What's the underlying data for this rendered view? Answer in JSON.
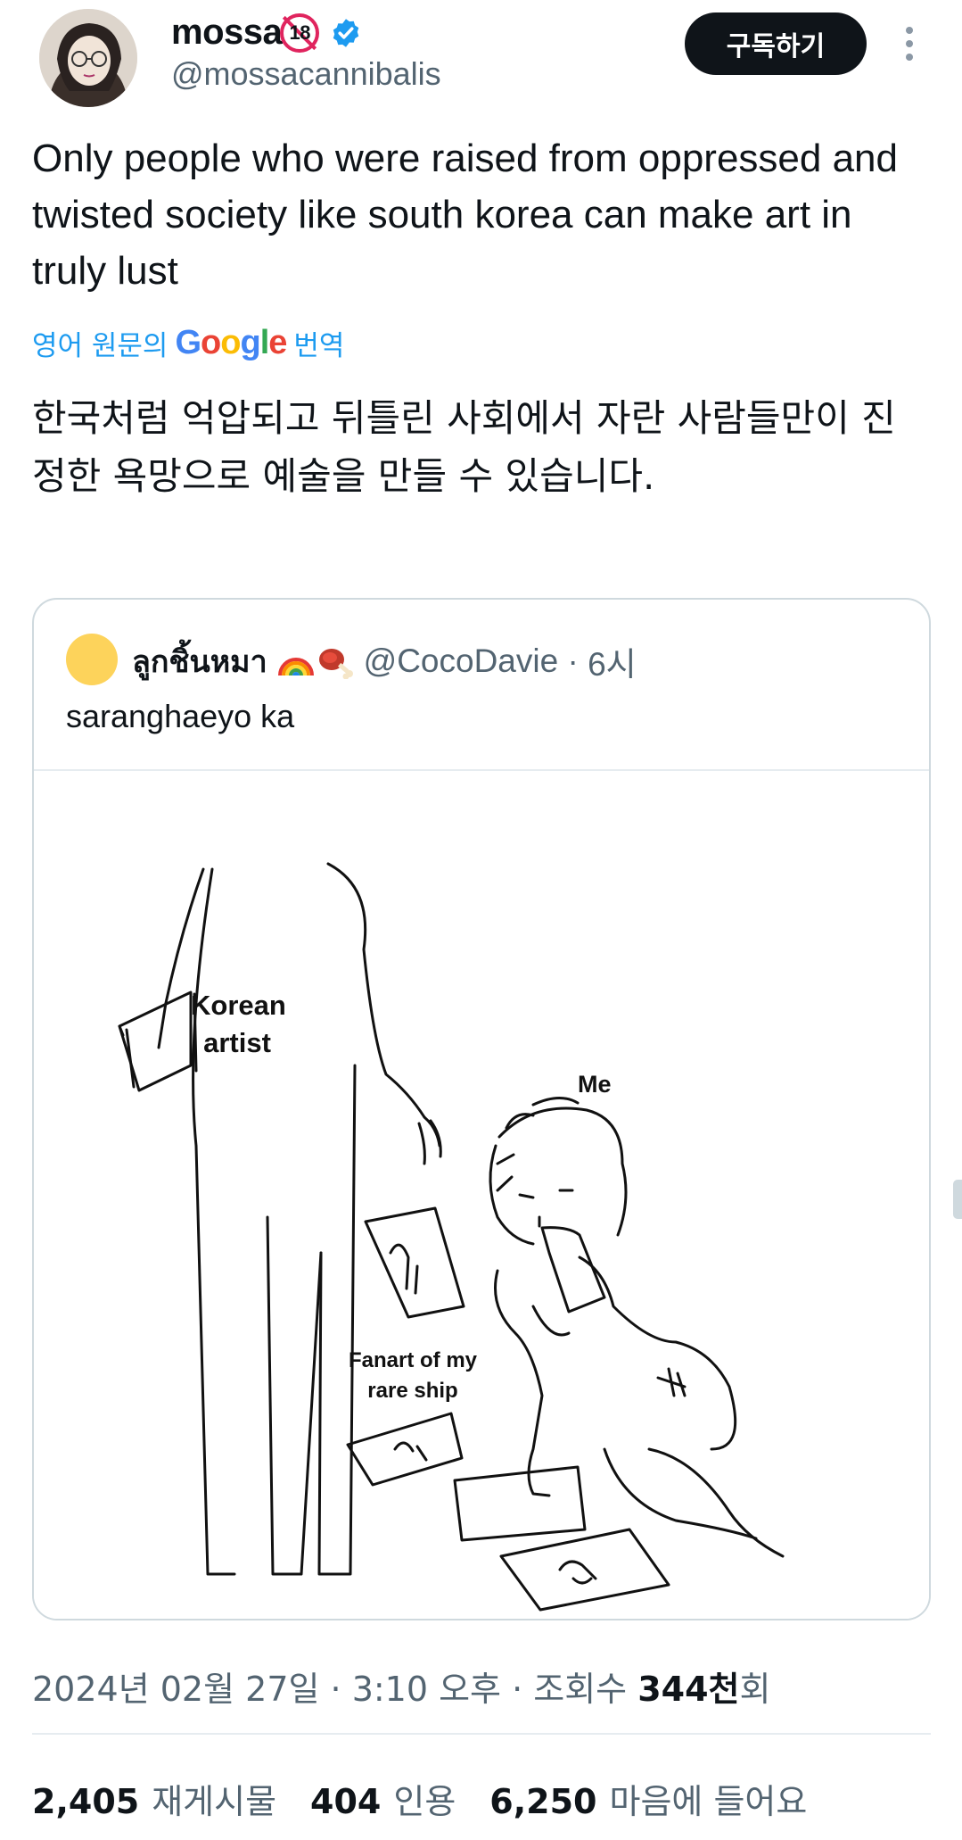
{
  "author": {
    "display_name": "mossa",
    "age_badge": "18",
    "handle": "@mossacannibalis"
  },
  "header": {
    "subscribe_label": "구독하기"
  },
  "tweet": {
    "text": "Only people who were raised from oppressed and twisted society like south korea can make art in truly lust",
    "translate_prefix": "영어 원문의",
    "translate_brand": "Google",
    "translate_suffix": "번역",
    "translated_text": "한국처럼 억압되고 뒤틀린 사회에서 자란 사람들만이 진정한 욕망으로 예술을 만들 수 있습니다."
  },
  "quote": {
    "name": "ลูกชิ้นหมา",
    "emoji": [
      "rainbow-emoji",
      "meat-on-bone-emoji"
    ],
    "handle": "@CocoDavie",
    "separator": " · ",
    "time": "6시",
    "text": "saranghaeyo ka",
    "image": {
      "label_artist": "Korean artist",
      "label_me": "Me",
      "label_fanart": "Fanart of my rare ship"
    }
  },
  "meta": {
    "timestamp": "2024년 02월 27일 · 3:10 오후 · 조회수 ",
    "views": "344천",
    "views_suffix": "회"
  },
  "stats": [
    {
      "count": "2,405",
      "label": "재게시물"
    },
    {
      "count": "404",
      "label": "인용"
    },
    {
      "count": "6,250",
      "label": "마음에 들어요"
    }
  ],
  "colors": {
    "link_blue": "#1d9bf0",
    "verified_blue": "#1d9bf0",
    "text_primary": "#0f1419",
    "text_secondary": "#536471",
    "badge_red": "#e0245e",
    "quote_avatar": "#fdd35b"
  }
}
